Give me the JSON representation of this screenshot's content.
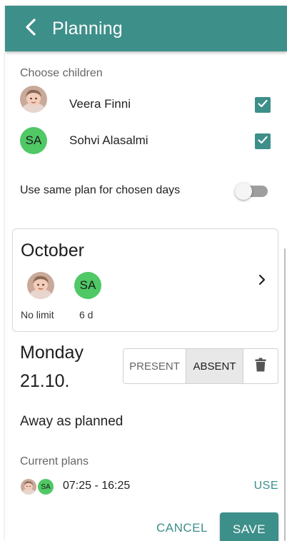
{
  "appbar": {
    "title": "Planning",
    "back_icon": "chevron-left-icon",
    "background": "#3d8f8a"
  },
  "children_section": {
    "label": "Choose children",
    "children": [
      {
        "name": "Veera Finni",
        "avatar": "photo",
        "checked": true
      },
      {
        "name": "Sohvi Alasalmi",
        "initials": "SA",
        "checked": true
      }
    ]
  },
  "same_plan": {
    "label": "Use same plan for chosen days",
    "enabled": false
  },
  "month_card": {
    "month": "October",
    "children": [
      {
        "avatar": "photo",
        "limit": "No limit"
      },
      {
        "initials": "SA",
        "limit": "6 d"
      }
    ],
    "chevron_icon": "chevron-right-icon"
  },
  "day": {
    "weekday": "Monday",
    "date": "21.10.",
    "present_label": "PRESENT",
    "absent_label": "ABSENT",
    "selected": "ABSENT",
    "delete_icon": "trash-icon"
  },
  "status_text": "Away as planned",
  "current_plans": {
    "label": "Current plans",
    "avatar_initials": "SA",
    "time": "07:25 - 16:25",
    "use_label": "USE"
  },
  "actions": {
    "cancel_label": "CANCEL",
    "save_label": "SAVE"
  },
  "colors": {
    "accent": "#3d8f8a",
    "initials_avatar": "#4fc865"
  }
}
